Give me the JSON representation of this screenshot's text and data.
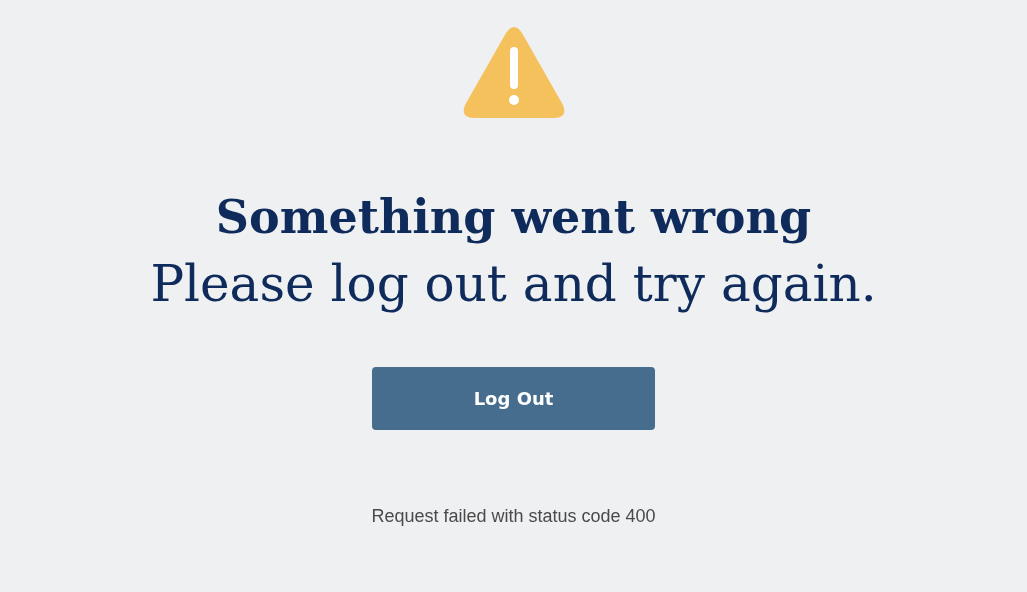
{
  "error": {
    "title": "Something went wrong",
    "message": "Please log out and try again."
  },
  "button": {
    "label": "Log Out"
  },
  "status": "Request failed with status code 400"
}
